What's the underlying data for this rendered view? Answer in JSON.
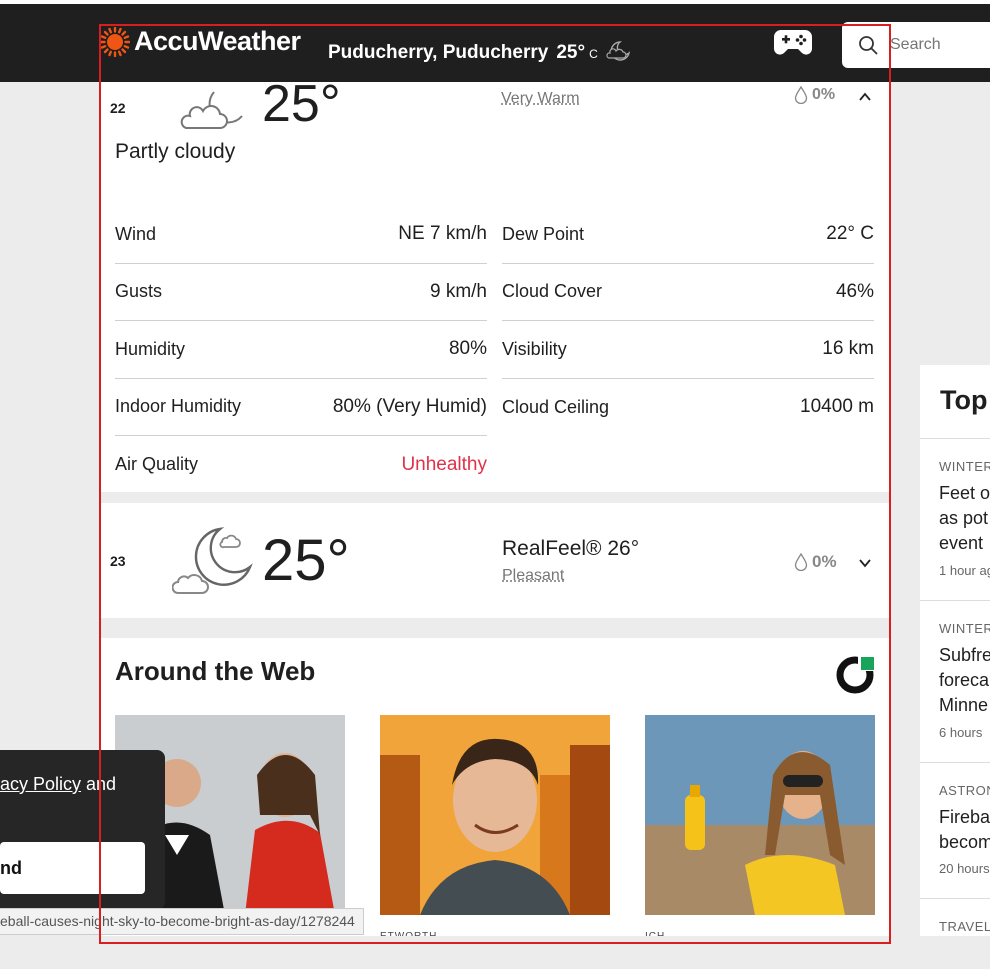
{
  "header": {
    "brand": "AccuWeather",
    "location": "Puducherry, Puducherry",
    "temperature": "25°",
    "unit": "C",
    "search_placeholder": "Search"
  },
  "hour_22": {
    "hour": "22",
    "temp": "25°",
    "realfeel_desc": "Very Warm",
    "precip": "0%",
    "condition": "Partly cloudy",
    "details_left": [
      {
        "label": "Wind",
        "value": "NE 7 km/h"
      },
      {
        "label": "Gusts",
        "value": "9 km/h"
      },
      {
        "label": "Humidity",
        "value": "80%"
      },
      {
        "label": "Indoor Humidity",
        "value": "80% (Very Humid)"
      },
      {
        "label": "Air Quality",
        "value": "Unhealthy"
      }
    ],
    "details_right": [
      {
        "label": "Dew Point",
        "value": "22° C"
      },
      {
        "label": "Cloud Cover",
        "value": "46%"
      },
      {
        "label": "Visibility",
        "value": "16 km"
      },
      {
        "label": "Cloud Ceiling",
        "value": "10400 m"
      }
    ]
  },
  "hour_23": {
    "hour": "23",
    "temp": "25°",
    "realfeel": "RealFeel® 26°",
    "realfeel_desc": "Pleasant",
    "precip": "0%"
  },
  "around_web": {
    "title": "Around the Web"
  },
  "sidebar": {
    "title": "Top S",
    "items": [
      {
        "category": "WINTER",
        "headline": [
          "Feet o",
          "as pot",
          "event"
        ],
        "time": "1 hour ag"
      },
      {
        "category": "WINTER",
        "headline": [
          "Subfre",
          "foreca",
          "Minne"
        ],
        "time": "6 hours"
      },
      {
        "category": "ASTRON",
        "headline": [
          "Fireba",
          "becom"
        ],
        "time": "20 hours"
      },
      {
        "category": "TRAVEL",
        "headline": [],
        "time": ""
      }
    ]
  },
  "banner": {
    "text_link": "acy Policy",
    "text_after": " and",
    "button": "nd"
  },
  "statusbar": {
    "url": "eball-causes-night-sky-to-become-bright-as-day/1278244"
  },
  "captions": {
    "img2": "ETWORTH",
    "img3": "ICH"
  },
  "colors": {
    "header_bg": "#1f1f1f",
    "accent_orange": "#f05514",
    "unhealthy": "#e0304a",
    "focus_outline": "#d81e1e"
  }
}
